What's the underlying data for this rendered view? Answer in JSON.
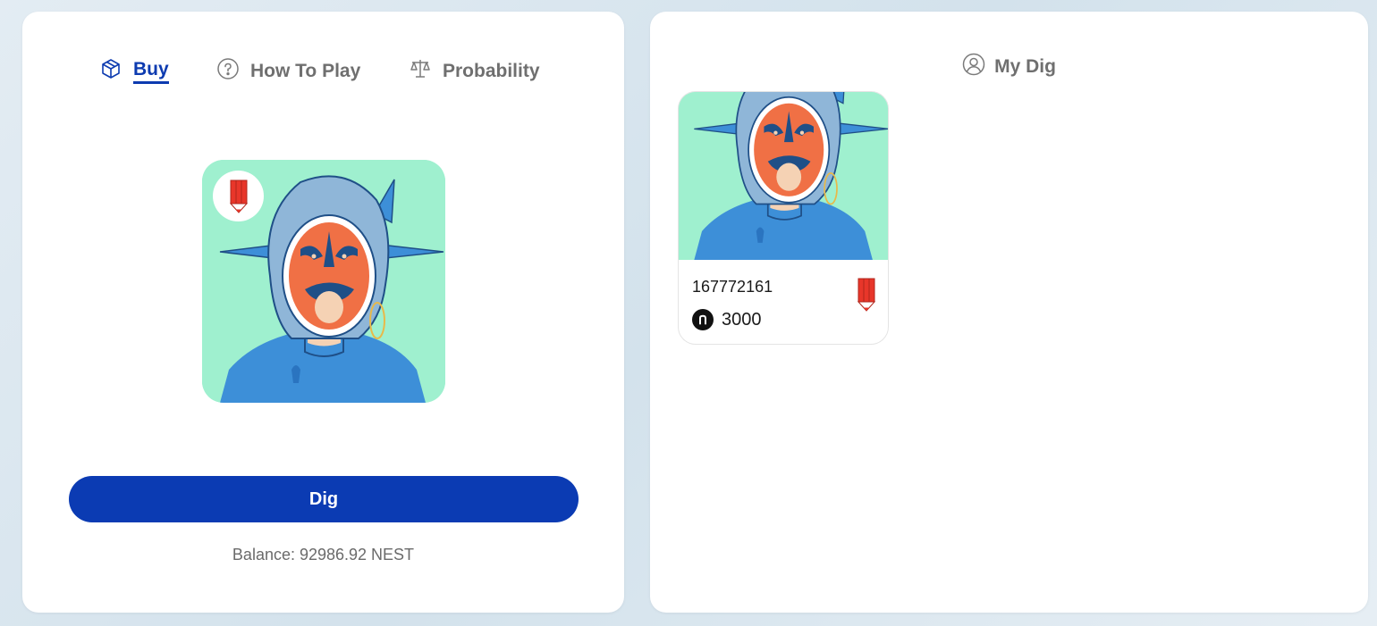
{
  "tabs": {
    "buy": "Buy",
    "how_to_play": "How To Play",
    "probability": "Probability"
  },
  "buy_panel": {
    "dig_label": "Dig",
    "balance_label": "Balance: 92986.92 NEST"
  },
  "my_dig": {
    "title": "My Dig",
    "items": [
      {
        "id": "167772161",
        "price": "3000"
      }
    ]
  },
  "colors": {
    "accent": "#0b3bb3",
    "art_background": "#9ff0cf",
    "shark_blue": "#3d8fd8",
    "mask_orange": "#f07045",
    "rarity_red": "#e8362a"
  },
  "icons": {
    "buy": "cube-icon",
    "how_to_play": "question-circle-icon",
    "probability": "scale-icon",
    "my_dig": "user-circle-icon",
    "coin": "nest-coin-icon",
    "rarity": "red-pencil-icon"
  }
}
